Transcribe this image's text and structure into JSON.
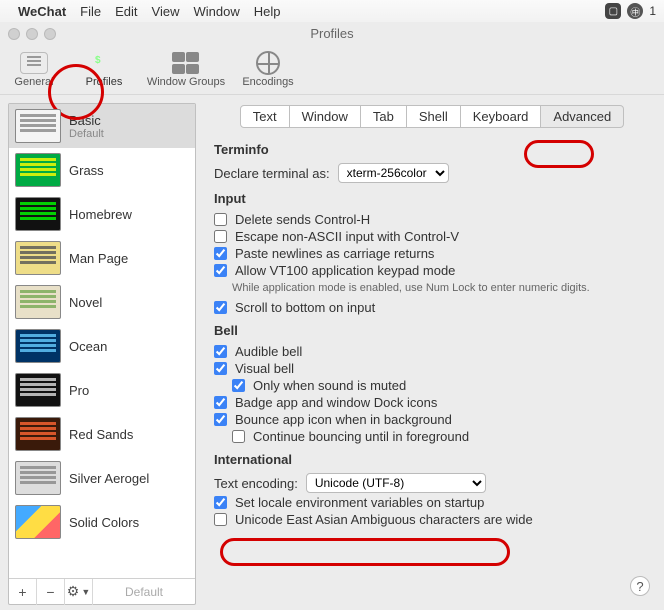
{
  "menubar": {
    "app": "WeChat",
    "items": [
      "File",
      "Edit",
      "View",
      "Window",
      "Help"
    ],
    "status_count": "1"
  },
  "window": {
    "title": "Profiles"
  },
  "toolbar": {
    "general": "General",
    "profiles": "Profiles",
    "window_groups": "Window Groups",
    "encodings": "Encodings"
  },
  "sidebar": {
    "items": [
      {
        "name": "Basic",
        "sub": "Default",
        "theme": "th-basic",
        "selected": true
      },
      {
        "name": "Grass",
        "theme": "th-grass"
      },
      {
        "name": "Homebrew",
        "theme": "th-homebrew"
      },
      {
        "name": "Man Page",
        "theme": "th-manpage"
      },
      {
        "name": "Novel",
        "theme": "th-novel"
      },
      {
        "name": "Ocean",
        "theme": "th-ocean"
      },
      {
        "name": "Pro",
        "theme": "th-pro"
      },
      {
        "name": "Red Sands",
        "theme": "th-redsands"
      },
      {
        "name": "Silver Aerogel",
        "theme": "th-silver"
      },
      {
        "name": "Solid Colors",
        "theme": "th-solid"
      }
    ],
    "footer": {
      "add": "+",
      "remove": "−",
      "menu": "✻▾",
      "default_label": "Default"
    }
  },
  "tabs": [
    "Text",
    "Window",
    "Tab",
    "Shell",
    "Keyboard",
    "Advanced"
  ],
  "active_tab": "Advanced",
  "terminfo": {
    "heading": "Terminfo",
    "declare_label": "Declare terminal as:",
    "declare_value": "xterm-256color"
  },
  "input": {
    "heading": "Input",
    "opts": [
      {
        "label": "Delete sends Control-H",
        "checked": false
      },
      {
        "label": "Escape non-ASCII input with Control-V",
        "checked": false
      },
      {
        "label": "Paste newlines as carriage returns",
        "checked": true
      },
      {
        "label": "Allow VT100 application keypad mode",
        "checked": true
      }
    ],
    "note": "While application mode is enabled, use Num Lock to enter numeric digits.",
    "scroll": {
      "label": "Scroll to bottom on input",
      "checked": true
    }
  },
  "bell": {
    "heading": "Bell",
    "opts": [
      {
        "label": "Audible bell",
        "checked": true,
        "indent": 0
      },
      {
        "label": "Visual bell",
        "checked": true,
        "indent": 0
      },
      {
        "label": "Only when sound is muted",
        "checked": true,
        "indent": 1
      },
      {
        "label": "Badge app and window Dock icons",
        "checked": true,
        "indent": 0
      },
      {
        "label": "Bounce app icon when in background",
        "checked": true,
        "indent": 0
      },
      {
        "label": "Continue bouncing until in foreground",
        "checked": false,
        "indent": 1
      }
    ]
  },
  "intl": {
    "heading": "International",
    "encoding_label": "Text encoding:",
    "encoding_value": "Unicode (UTF-8)",
    "opts": [
      {
        "label": "Set locale environment variables on startup",
        "checked": true
      },
      {
        "label": "Unicode East Asian Ambiguous characters are wide",
        "checked": false
      }
    ]
  },
  "help": "?"
}
